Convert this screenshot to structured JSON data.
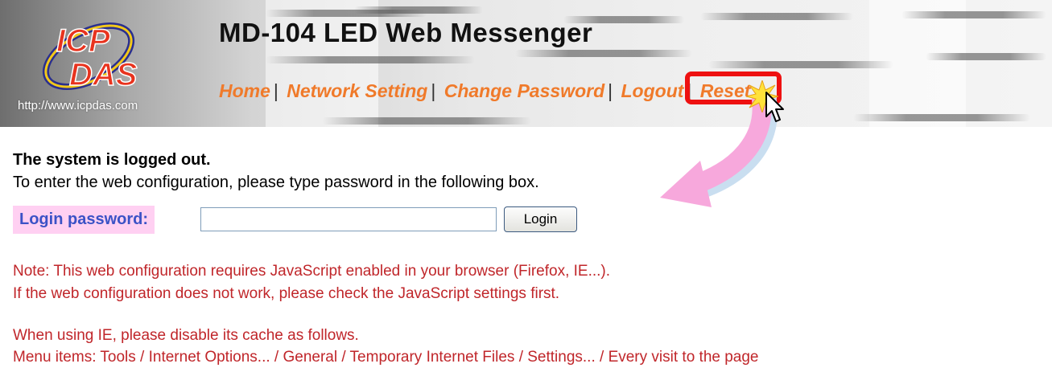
{
  "header": {
    "title": "MD-104 LED Web Messenger",
    "logo_text_1": "ICP",
    "logo_text_2": "DAS",
    "logo_url": "http://www.icpdas.com",
    "nav": [
      {
        "label": "Home"
      },
      {
        "label": "Network Setting"
      },
      {
        "label": "Change Password"
      },
      {
        "label": "Logout"
      },
      {
        "label": "Reset"
      }
    ],
    "nav_separator": "|",
    "annotation_color": "#ee1111"
  },
  "main": {
    "status_heading": "The system is logged out.",
    "instruction": "To enter the web configuration, please type password in the following box.",
    "login_label": "Login password:",
    "password_value": "",
    "login_button": "Login",
    "notes": [
      "Note: This web configuration requires JavaScript enabled in your browser (Firefox, IE...).",
      "If the web configuration does not work, please check the JavaScript settings first.",
      "When using IE, please disable its cache as follows.",
      "Menu items: Tools / Internet Options... / General / Temporary Internet Files / Settings... / Every visit to the page"
    ]
  },
  "colors": {
    "nav_link": "#f07a2a",
    "label_bg": "#ffd0f2",
    "label_text": "#3b52c6",
    "note_text": "#c0262a",
    "arrow": "#f7a8dc"
  }
}
